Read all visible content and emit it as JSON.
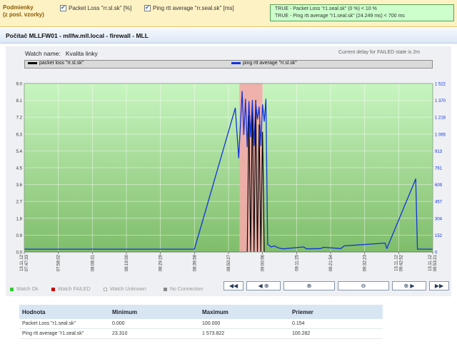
{
  "conditions": {
    "label_line1": "Podmienky",
    "label_line2": "(z posl. vzorky)",
    "checkbox1_label": "Packet Loss \"rr.sl.sk\" [%]",
    "checkbox2_label": "Ping rtt average \"rr.seal.sk\" [ms]",
    "status_line1": "TRUE - Packet Loss \"r1.seal.sk\" (0 %) < 10 %",
    "status_line2": "TRUE - Ping rtt average \"r1.seal.sk\" (24.249 ms) < 700 ms"
  },
  "page_title": "Počítač MLLFW01 - mllfw.mll.local - firewall - MLL",
  "watch": {
    "name_label": "Watch name:",
    "name_value": "Kvalita linky",
    "delay_text": "Current delay for FAILED state is 2m"
  },
  "legend": {
    "series1": "packet loss \"rr.sl.sk\"",
    "series2": "ping rtt average \"rr.sl.sk\""
  },
  "watch_legend": {
    "ok": "Watch Ok",
    "failed": "Watch FAILED",
    "unknown": "Watch Unknown",
    "no_connection": "No Connection"
  },
  "nav": {
    "first": "◀◀",
    "prev": "◀ ⊕",
    "zoom_in": "⊕",
    "zoom_out": "⊖",
    "next": "⊕ ▶",
    "last": "▶▶"
  },
  "table": {
    "headers": [
      "Hodnota",
      "Minimum",
      "Maximum",
      "Priemer"
    ],
    "rows": [
      [
        "Packet Loss \"r1.seal.sk\"",
        "0.000",
        "100.000",
        "0.154"
      ],
      [
        "Ping rtt average \"r1.seal.sk\"",
        "23.310",
        "1 573.822",
        "100.282"
      ]
    ]
  },
  "colors": {
    "ok": "#33cc33",
    "failed": "#cc0000",
    "unknown": "#ffffff",
    "no_connection": "#888888",
    "series_loss": "#000000",
    "series_ping": "#1133dd",
    "failed_band": "#f4aaaa"
  },
  "chart_data": {
    "type": "line",
    "x_tick_labels": [
      "13.11.12 07:47:33",
      "07:58:02",
      "08:08:31",
      "08:19:00",
      "08:29:29",
      "08:39:58",
      "08:50:27",
      "09:00:56",
      "09:11:25",
      "09:21:54",
      "09:32:23",
      "13.11.12 09:42:52",
      "13.11.12 09:53:21"
    ],
    "y_left_ticks": [
      "0.0",
      "0.9",
      "1.8",
      "2.7",
      "3.6",
      "4.5",
      "5.4",
      "6.3",
      "7.2",
      "8.1",
      "9.0"
    ],
    "y_right_ticks": [
      "0",
      "152",
      "304",
      "457",
      "609",
      "761",
      "913",
      "1 065",
      "1 218",
      "1 370",
      "1 522"
    ],
    "ylim_left": [
      0,
      9
    ],
    "ylim_right": [
      0,
      1522
    ],
    "grid": true,
    "series": [
      {
        "name": "packet loss \"rr.sl.sk\"",
        "axis": "left",
        "x": [
          0,
          6.55,
          6.6,
          6.65,
          6.7,
          6.75,
          6.8,
          6.85,
          6.9,
          6.95,
          7.0,
          7.05,
          7.1,
          7.2,
          12
        ],
        "y": [
          0,
          0,
          7.3,
          0,
          7.8,
          0,
          8.1,
          0,
          6.8,
          0,
          6.4,
          0,
          0,
          0,
          0
        ]
      },
      {
        "name": "ping rtt average \"rr.sl.sk\"",
        "axis": "right",
        "x": [
          0,
          5.0,
          6.2,
          6.3,
          6.4,
          6.45,
          6.5,
          6.55,
          6.6,
          6.65,
          6.7,
          6.75,
          6.8,
          6.85,
          6.9,
          6.95,
          7.0,
          7.05,
          7.1,
          7.15,
          7.25,
          7.35,
          7.45,
          7.6,
          8.2,
          8.3,
          8.7,
          8.8,
          9.3,
          9.4,
          10.6,
          10.65,
          11.5,
          11.55,
          12
        ],
        "y": [
          25,
          25,
          1300,
          850,
          1450,
          1060,
          1380,
          950,
          1360,
          1040,
          1370,
          960,
          1350,
          1200,
          1310,
          960,
          1330,
          1180,
          1380,
          70,
          45,
          55,
          38,
          28,
          45,
          28,
          30,
          42,
          30,
          55,
          80,
          30,
          660,
          25,
          25
        ]
      }
    ],
    "failed_band": [
      6.32,
      7.0
    ]
  }
}
